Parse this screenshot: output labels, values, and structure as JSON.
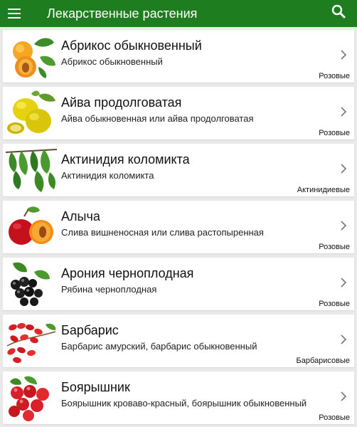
{
  "app": {
    "title": "Лекарственные растения"
  },
  "colors": {
    "appbar": "#1e7d1e",
    "background": "#e9e9e9",
    "card": "#ffffff"
  },
  "plants": [
    {
      "name": "Абрикос обыкновенный",
      "desc": "Абрикос обыкновенный",
      "family": "Розовые",
      "image": "apricot"
    },
    {
      "name": "Айва продолговатая",
      "desc": "Айва обыкновенная или айва продолговатая",
      "family": "Розовые",
      "image": "quince"
    },
    {
      "name": "Актинидия коломикта",
      "desc": "Актинидия коломикта",
      "family": "Актинидиевые",
      "image": "actinidia"
    },
    {
      "name": "Алыча",
      "desc": "Слива вишненосная или слива растопыренная",
      "family": "Розовые",
      "image": "cherry-plum"
    },
    {
      "name": "Арония черноплодная",
      "desc": "Рябина черноплодная",
      "family": "Розовые",
      "image": "aronia"
    },
    {
      "name": "Барбарис",
      "desc": "Барбарис амурский, барбарис обыкновенный",
      "family": "Барбарисовые",
      "image": "barberry"
    },
    {
      "name": "Боярышник",
      "desc": "Боярышник кроваво-красный, боярышник обыкновенный",
      "family": "Розовые",
      "image": "hawthorn"
    }
  ]
}
